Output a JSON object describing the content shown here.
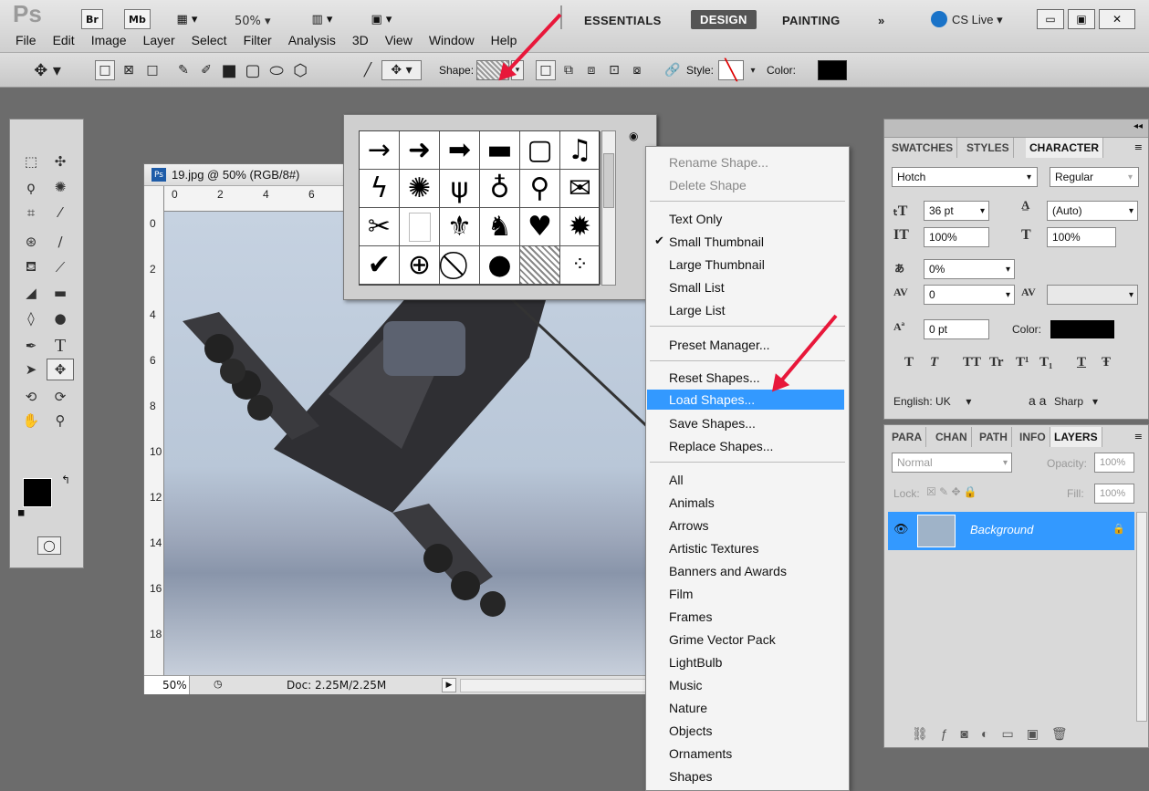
{
  "app": {
    "logo": "Ps",
    "bridge": "Br",
    "mini_bridge": "Mb",
    "zoom": "50%"
  },
  "workspaces": {
    "essentials": "ESSENTIALS",
    "design": "DESIGN",
    "painting": "PAINTING",
    "more": "»",
    "cs_live": "CS Live"
  },
  "menus": [
    "File",
    "Edit",
    "Image",
    "Layer",
    "Select",
    "Filter",
    "Analysis",
    "3D",
    "View",
    "Window",
    "Help"
  ],
  "options_bar": {
    "shape_label": "Shape:",
    "style_label": "Style:",
    "color_label": "Color:"
  },
  "document": {
    "title": "19.jpg @ 50% (RGB/8#)",
    "zoom": "50%",
    "doc_size": "Doc: 2.25M/2.25M",
    "ruler_h": [
      "0",
      "2",
      "4",
      "6"
    ],
    "ruler_v": [
      "0",
      "2",
      "4",
      "6",
      "8",
      "10",
      "12",
      "14",
      "16",
      "18"
    ]
  },
  "shape_picker": {
    "shapes": [
      "arrow-thin",
      "arrow-bold",
      "arrow-heavy",
      "banner",
      "frame",
      "music-note",
      "lightning",
      "starburst",
      "grass",
      "lightbulb",
      "pushpin",
      "envelope",
      "scissors",
      "blank-page",
      "fleur-de-lis",
      "cat",
      "heart",
      "splat",
      "checkmark",
      "crosshair",
      "no-sign",
      "speech-bubble",
      "texture-hatch",
      "diamond-grid"
    ]
  },
  "context_menu": {
    "items": [
      {
        "label": "Rename Shape...",
        "disabled": true
      },
      {
        "label": "Delete Shape",
        "disabled": true
      },
      {
        "label": "Text Only"
      },
      {
        "label": "Small Thumbnail",
        "checked": true
      },
      {
        "label": "Large Thumbnail"
      },
      {
        "label": "Small List"
      },
      {
        "label": "Large List"
      },
      {
        "label": "Preset Manager..."
      },
      {
        "label": "Reset Shapes..."
      },
      {
        "label": "Load Shapes...",
        "highlighted": true
      },
      {
        "label": "Save Shapes..."
      },
      {
        "label": "Replace Shapes..."
      },
      {
        "label": "All"
      },
      {
        "label": "Animals"
      },
      {
        "label": "Arrows"
      },
      {
        "label": "Artistic Textures"
      },
      {
        "label": "Banners and Awards"
      },
      {
        "label": "Film"
      },
      {
        "label": "Frames"
      },
      {
        "label": "Grime Vector Pack"
      },
      {
        "label": "LightBulb"
      },
      {
        "label": "Music"
      },
      {
        "label": "Nature"
      },
      {
        "label": "Objects"
      },
      {
        "label": "Ornaments"
      },
      {
        "label": "Shapes"
      }
    ]
  },
  "character_panel": {
    "tabs": [
      "SWATCHES",
      "STYLES",
      "CHARACTER"
    ],
    "font_family": "Hotch",
    "font_style": "Regular",
    "size": "36 pt",
    "leading": "(Auto)",
    "vscale": "100%",
    "hscale": "100%",
    "tsume": "0%",
    "kerning": "0",
    "tracking": "",
    "baseline": "0 pt",
    "color_label": "Color:",
    "styles": [
      "T",
      "T",
      "TT",
      "Tr",
      "T¹",
      "T₁",
      "T",
      "Ŧ"
    ],
    "language": "English: UK",
    "aa_label": "a a",
    "antialias": "Sharp"
  },
  "layers_panel": {
    "tabs": [
      "PARA",
      "CHAN",
      "PATH",
      "INFO",
      "LAYERS"
    ],
    "blend": "Normal",
    "opacity_label": "Opacity:",
    "opacity": "100%",
    "lock_label": "Lock:",
    "fill_label": "Fill:",
    "fill": "100%",
    "layer_name": "Background"
  }
}
